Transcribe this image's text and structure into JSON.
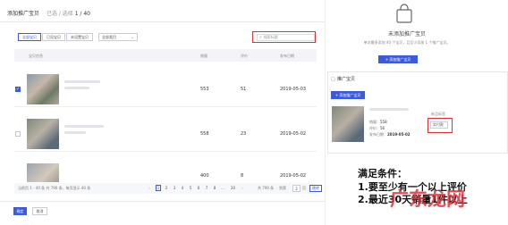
{
  "left": {
    "header": {
      "title": "添加推广宝贝",
      "selected_label": "已选 / 选择",
      "selected_count": "1 / 40"
    },
    "filters": {
      "segments": [
        {
          "label": "全部宝贝",
          "active": true
        },
        {
          "label": "已设宝贝",
          "active": false
        },
        {
          "label": "未设置宝贝",
          "active": false
        }
      ],
      "dropdown_label": "全部类目"
    },
    "search": {
      "placeholder": "搜索标题"
    },
    "table": {
      "columns": [
        "宝贝信息",
        "销量",
        "评价",
        "发布日期"
      ],
      "rows": [
        {
          "checked": true,
          "sales": "553",
          "reviews": "51",
          "date": "2019-05-03"
        },
        {
          "checked": false,
          "sales": "558",
          "reviews": "23",
          "date": "2019-05-02"
        },
        {
          "checked": false,
          "sales": "400",
          "reviews": "8",
          "date": "2019-05-02"
        }
      ]
    },
    "pager": {
      "info": "当前页 1 - 40 条 共 790 条，每页显示 40 条",
      "pages": [
        "1",
        "2",
        "3",
        "4",
        "5",
        "6",
        "7",
        "8",
        "...",
        "20"
      ],
      "total": "共 790 条",
      "goto_label": "到第",
      "goto_value": "2",
      "goto_unit": "页",
      "go_button": "跳转"
    },
    "footer": {
      "confirm": "确定",
      "cancel": "取消"
    }
  },
  "right": {
    "empty": {
      "title": "未添加推广宝贝",
      "desc": "单次最多添加 40 个宝贝，且至少添加 1 个推广宝贝。",
      "button": "+ 添加推广宝贝"
    },
    "card": {
      "title": "推广宝贝",
      "add_button": "+ 添加推广宝贝",
      "item": {
        "sales_label": "销量：",
        "sales": "558",
        "reviews_label": "评价：",
        "reviews": "56",
        "date_label": "发布日期：",
        "date": "2019-05-02",
        "input_label": "新品标签",
        "input_value": "实付款"
      }
    },
    "note": {
      "heading": "满足条件：",
      "line1": "1.要至少有一个以上评价",
      "line2": "2.最近30天销量1件以上"
    },
    "watermark": "广东龙网"
  },
  "colors": {
    "accent": "#3b5bdb",
    "highlight": "#e0303a"
  }
}
